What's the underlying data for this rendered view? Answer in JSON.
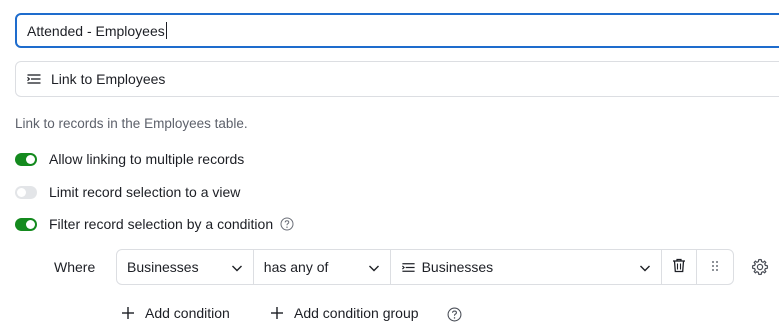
{
  "field": {
    "name_value": "Attended - Employees",
    "type_label": "Link to Employees",
    "type_icon": "link-list-icon"
  },
  "description": "Link to records in the Employees table.",
  "options": [
    {
      "label": "Allow linking to multiple records",
      "enabled": true
    },
    {
      "label": "Limit record selection to a view",
      "enabled": false
    },
    {
      "label": "Filter record selection by a condition",
      "enabled": true
    }
  ],
  "condition": {
    "where_label": "Where",
    "field": "Businesses",
    "operator": "has any of",
    "value": "Businesses"
  },
  "actions": {
    "add_condition": "Add condition",
    "add_condition_group": "Add condition group"
  },
  "colors": {
    "accent": "#1e6ccd",
    "toggle_on": "#148a1e",
    "toggle_off": "#e3e5e8",
    "muted_text": "#5d616b",
    "border": "#dcdee2"
  }
}
